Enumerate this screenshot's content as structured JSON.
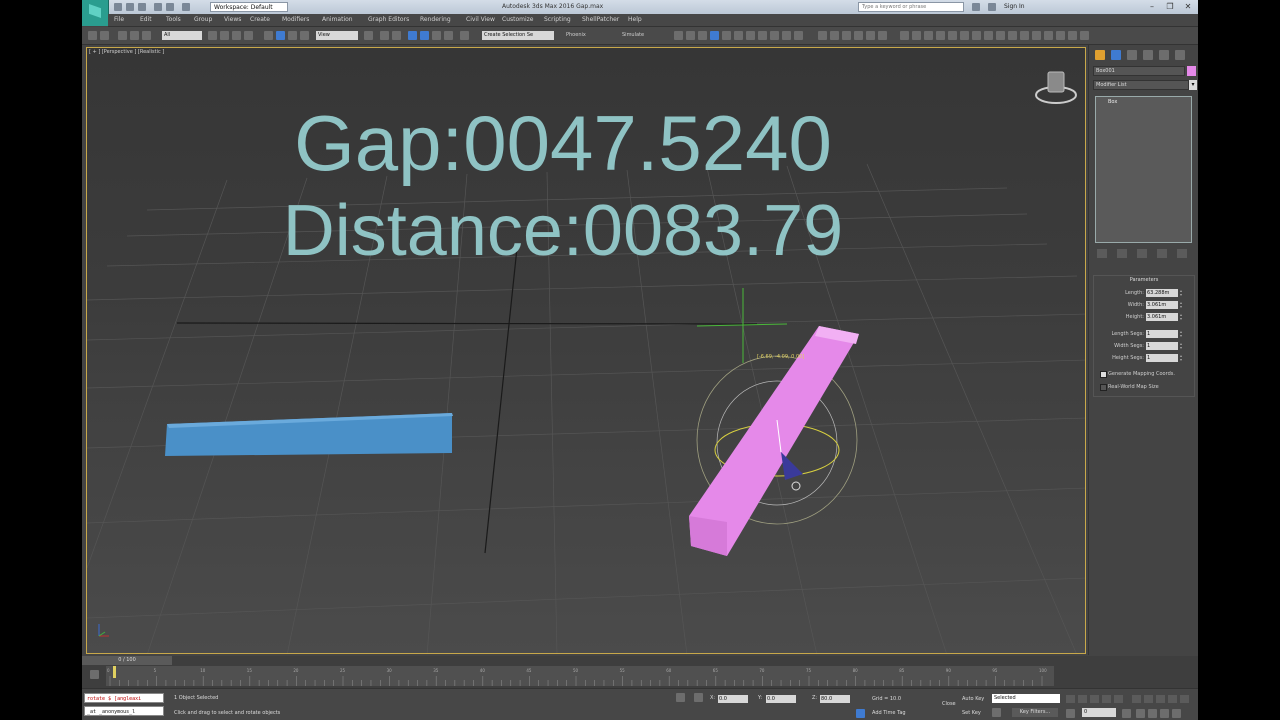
{
  "titlebar": {
    "workspace": "Workspace: Default",
    "title": "Autodesk 3ds Max 2016    Gap.max",
    "search_placeholder": "Type a keyword or phrase",
    "sign_in": "Sign In"
  },
  "menus": [
    "File",
    "Edit",
    "Tools",
    "Group",
    "Views",
    "Create",
    "Modifiers",
    "Animation",
    "Graph Editors",
    "Rendering",
    "Civil View",
    "Customize",
    "Scripting",
    "ShellPatcher",
    "Help"
  ],
  "toolbar": {
    "selection_filter": "All",
    "ref_coord": "View",
    "named_selection": "Create Selection Se",
    "btn_a": "Phoenix",
    "btn_b": "Simulate"
  },
  "viewport": {
    "label": "[ + ] [Perspective ] [Realistic ]",
    "gap_text": "Gap:0047.5240",
    "distance_text": "Distance:0083.79",
    "coord_readout": "[-6.69, -4.09, 0.00]",
    "colors": {
      "blue_box": "#4a90c8",
      "pink_box": "#e589e9",
      "text": "#8fc3c4"
    }
  },
  "command_panel": {
    "object_name": "Box001",
    "object_color": "#e589e9",
    "modifier_list": "Modifier List",
    "stack_item": "Box",
    "params_title": "Parameters",
    "params": [
      {
        "label": "Length:",
        "value": "63.288m"
      },
      {
        "label": "Width:",
        "value": "3.061m"
      },
      {
        "label": "Height:",
        "value": "3.061m"
      },
      {
        "label": "Length Segs:",
        "value": "1"
      },
      {
        "label": "Width Segs:",
        "value": "1"
      },
      {
        "label": "Height Segs:",
        "value": "1"
      }
    ],
    "check_1": "Generate Mapping Coords.",
    "check_2": "Real-World Map Size"
  },
  "timeline": {
    "slider": "0 / 100",
    "ticks": [
      "0",
      "5",
      "10",
      "15",
      "20",
      "25",
      "30",
      "35",
      "40",
      "45",
      "50",
      "55",
      "60",
      "65",
      "70",
      "75",
      "80",
      "85",
      "90",
      "95",
      "100"
    ]
  },
  "status": {
    "maxscript_1": "rotate $ [angleaxi",
    "maxscript_2": "_at _anonymous_l",
    "selection": "1 Object Selected",
    "prompt": "Click and drag to select and rotate objects",
    "x_label": "X:",
    "x_value": "0.0",
    "y_label": "Y:",
    "y_value": "0.0",
    "z_label": "Z:",
    "z_value": "80.0",
    "grid": "Grid = 10.0",
    "add_time_tag": "Add Time Tag",
    "auto_key": "Auto Key",
    "auto_key_mode": "Selected",
    "set_key": "Set Key",
    "key_filters": "Key Filters...",
    "close": "Close",
    "frame": "0"
  }
}
